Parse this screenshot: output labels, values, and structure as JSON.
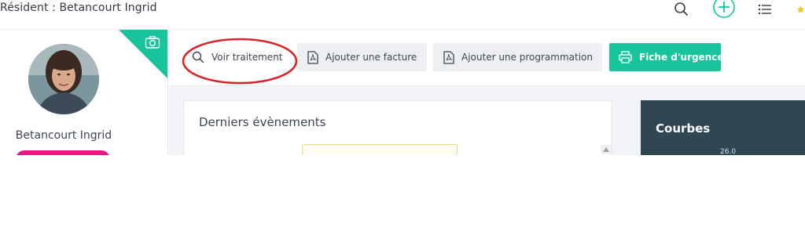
{
  "header": {
    "title": "Résident : Betancourt Ingrid",
    "icons": [
      "search-icon",
      "add-circle-icon",
      "list-icon",
      "star-icon"
    ]
  },
  "sidebar": {
    "resident_name": "Betancourt Ingrid",
    "camera_icon": "camera-icon",
    "accent_color": "#17c49c",
    "pill_color": "#e5197f"
  },
  "toolbar": {
    "buttons": [
      {
        "label": "Voir traitement",
        "icon": "search-icon"
      },
      {
        "label": "Ajouter une facture",
        "icon": "pdf-icon"
      },
      {
        "label": "Ajouter une programmation",
        "icon": "pdf-icon"
      },
      {
        "label": "Fiche d'urgence",
        "icon": "printer-icon",
        "color": "#17c49c"
      }
    ],
    "annotation_color": "#d8232a"
  },
  "events": {
    "title": "Derniers évènements"
  },
  "curves": {
    "title": "Courbes",
    "tick_label": "26.0",
    "background": "#2f4655"
  }
}
